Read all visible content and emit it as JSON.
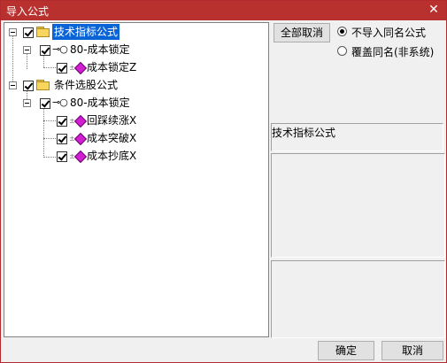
{
  "window": {
    "title": "导入公式",
    "close_glyph": "✕"
  },
  "tree": {
    "nodes": [
      {
        "label": "技术指标公式"
      },
      {
        "label": "80-成本锁定"
      },
      {
        "label": "成本锁定Z"
      },
      {
        "label": "条件选股公式"
      },
      {
        "label": "80-成本锁定"
      },
      {
        "label": "回踩续涨X"
      },
      {
        "label": "成本突破X"
      },
      {
        "label": "成本抄底X"
      }
    ]
  },
  "right": {
    "select_all_cancel": "全部取消",
    "radio_options": [
      {
        "label": "不导入同名公式",
        "selected": true
      },
      {
        "label": "覆盖同名(非系统)",
        "selected": false
      }
    ],
    "info_title": "技术指标公式"
  },
  "footer": {
    "ok": "确定",
    "cancel": "取消"
  }
}
